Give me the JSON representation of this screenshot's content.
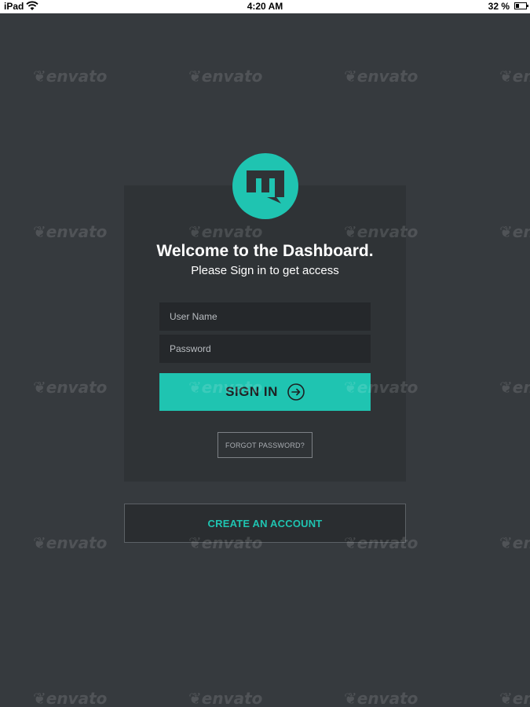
{
  "status_bar": {
    "device": "iPad",
    "time": "4:20 AM",
    "battery": "32 %",
    "battery_level": 0.32
  },
  "logo": {
    "icon": "m-logo-icon",
    "color": "#1fc4b1"
  },
  "header": {
    "title": "Welcome to the Dashboard.",
    "subtitle": "Please Sign in to get access"
  },
  "form": {
    "username_placeholder": "User Name",
    "username_value": "",
    "password_placeholder": "Password",
    "password_value": "",
    "signin_label": "SIGN IN",
    "signin_icon": "arrow-right-circle-icon",
    "forgot_label": "FORGOT PASSWORD?"
  },
  "footer": {
    "create_label": "CREATE AN ACCOUNT"
  },
  "watermark": {
    "text": "envato",
    "icon": "envato-leaf-icon"
  },
  "colors": {
    "accent": "#1fc4b1",
    "background": "#363a3e",
    "card": "#2f3336",
    "input": "#25282b"
  }
}
